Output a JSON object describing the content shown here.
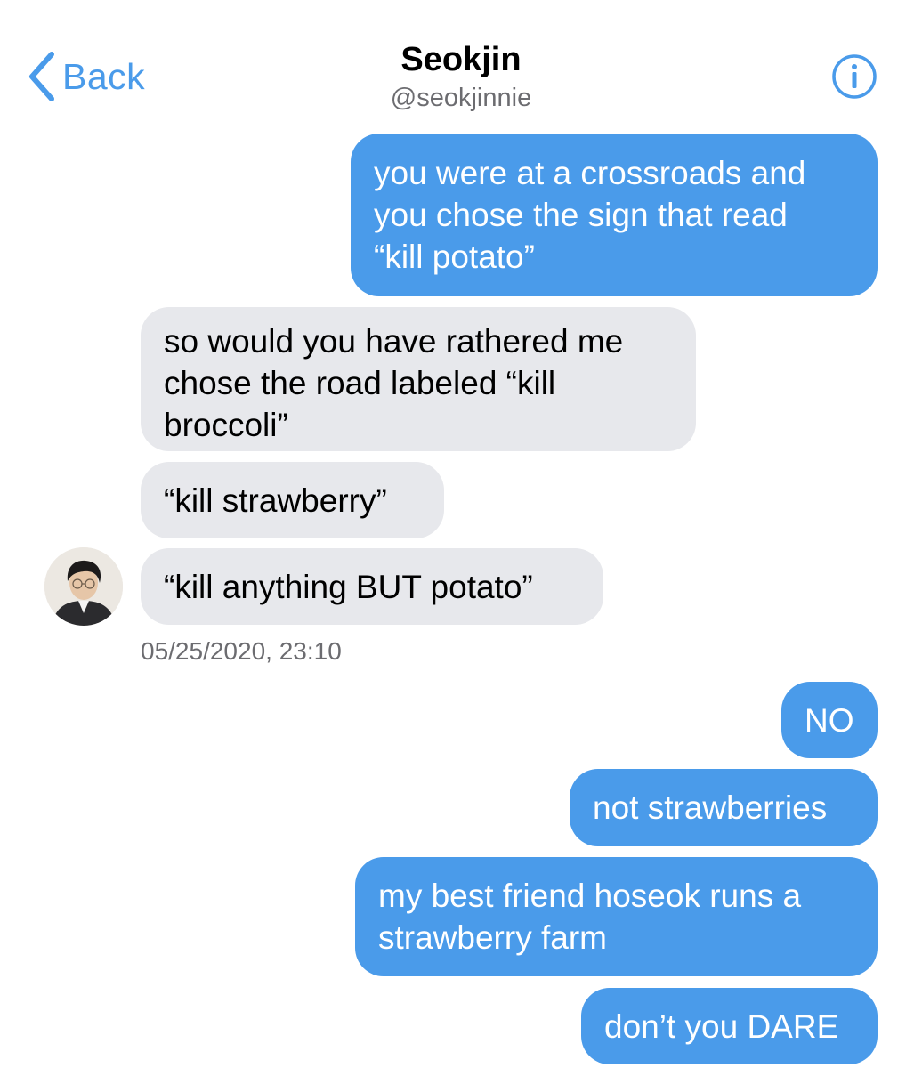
{
  "header": {
    "back_label": "Back",
    "contact_name": "Seokjin",
    "contact_handle": "@seokjinnie"
  },
  "messages": [
    {
      "direction": "outgoing",
      "text": "you were at a crossroads and\nyou chose the sign that read\n“kill potato”"
    },
    {
      "direction": "incoming",
      "text": "so would you have rathered me\nchose the road labeled “kill\nbroccoli”"
    },
    {
      "direction": "incoming",
      "text": "“kill strawberry”"
    },
    {
      "direction": "incoming",
      "text": "“kill anything BUT potato”"
    },
    {
      "direction": "outgoing",
      "text": "NO"
    },
    {
      "direction": "outgoing",
      "text": "not strawberries"
    },
    {
      "direction": "outgoing",
      "text": "my best friend hoseok runs a\nstrawberry farm"
    },
    {
      "direction": "outgoing",
      "text": "don’t you DARE"
    }
  ],
  "timestamp": "05/25/2020, 23:10",
  "icons": {
    "back": "chevron-left-icon",
    "info": "info-icon"
  },
  "colors": {
    "accent": "#4a9bea",
    "incoming_bubble": "#e7e8ec",
    "secondary_text": "#6c6c70"
  }
}
